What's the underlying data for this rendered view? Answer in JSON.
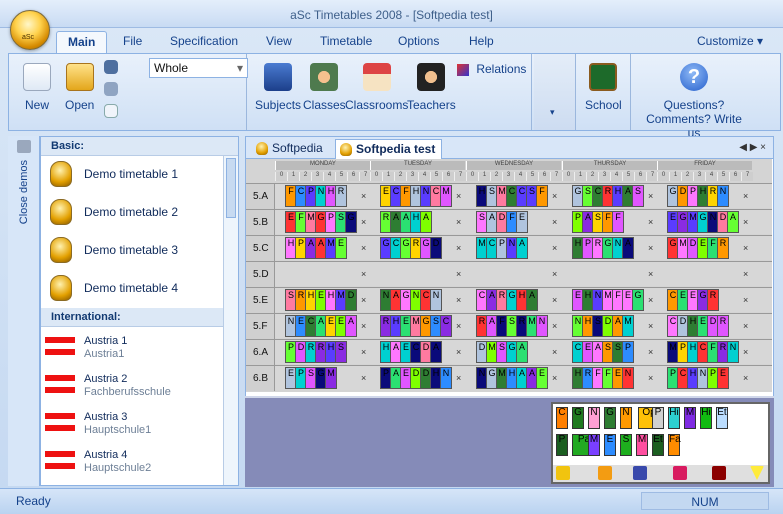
{
  "window": {
    "title": "aSc Timetables 2008  - [Softpedia test]"
  },
  "tabs": [
    "Main",
    "File",
    "Specification",
    "View",
    "Timetable",
    "Options",
    "Help"
  ],
  "customize": "Customize ▾",
  "ribbon": {
    "new": "New",
    "open": "Open",
    "select": "Whole",
    "subjects": "Subjects",
    "classes": "Classes",
    "classrooms": "Classrooms",
    "teachers": "Teachers",
    "relations": "Relations",
    "school": "School",
    "questions": "Questions?",
    "comments": "Comments? Write us"
  },
  "side": {
    "close": "Close demos",
    "basic": "Basic:",
    "international": "International:"
  },
  "basic_demos": [
    "Demo timetable 1",
    "Demo timetable 2",
    "Demo timetable 3",
    "Demo timetable 4"
  ],
  "international_demos": [
    {
      "name": "Austria 1",
      "sub": "Austria1"
    },
    {
      "name": "Austria 2",
      "sub": "Fachberufsschule"
    },
    {
      "name": "Austria 3",
      "sub": "Hauptschule1"
    },
    {
      "name": "Austria 4",
      "sub": "Hauptschule2"
    }
  ],
  "doc_tabs": [
    "Softpedia",
    "Softpedia test"
  ],
  "days": [
    "MONDAY",
    "TUESDAY",
    "WEDNESDAY",
    "THURSDAY",
    "FRIDAY"
  ],
  "periods": [
    "0",
    "1",
    "2",
    "3",
    "4",
    "5",
    "6",
    "7"
  ],
  "classes": [
    "5.A",
    "5.B",
    "5.C",
    "5.D",
    "5.E",
    "5.F",
    "6.A",
    "6.B"
  ],
  "palette": [
    "C",
    "G",
    "N",
    "G",
    "N",
    "Op",
    "P",
    "Hi",
    "M",
    "Hi",
    "Et",
    "P",
    "Pa",
    "M",
    "E",
    "S",
    "M",
    "Et",
    "Fa"
  ],
  "status": {
    "ready": "Ready",
    "num": "NUM"
  },
  "colors": {
    "accent": "#15428b",
    "ribbon": "#dbe8f7",
    "grid": "#d4d4d4"
  }
}
